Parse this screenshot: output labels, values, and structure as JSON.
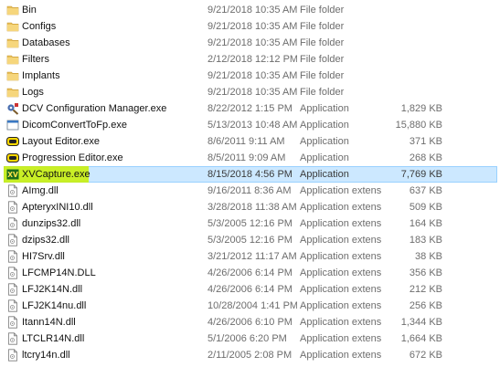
{
  "files": [
    {
      "name": "Bin",
      "date": "9/21/2018 10:35 AM",
      "type": "File folder",
      "size": "",
      "icon": "folder-icon"
    },
    {
      "name": "Configs",
      "date": "9/21/2018 10:35 AM",
      "type": "File folder",
      "size": "",
      "icon": "folder-icon"
    },
    {
      "name": "Databases",
      "date": "9/21/2018 10:35 AM",
      "type": "File folder",
      "size": "",
      "icon": "folder-icon"
    },
    {
      "name": "Filters",
      "date": "2/12/2018 12:12 PM",
      "type": "File folder",
      "size": "",
      "icon": "folder-icon"
    },
    {
      "name": "Implants",
      "date": "9/21/2018 10:35 AM",
      "type": "File folder",
      "size": "",
      "icon": "folder-icon"
    },
    {
      "name": "Logs",
      "date": "9/21/2018 10:35 AM",
      "type": "File folder",
      "size": "",
      "icon": "folder-icon"
    },
    {
      "name": "DCV Configuration Manager.exe",
      "date": "8/22/2012 1:15 PM",
      "type": "Application",
      "size": "1,829 KB",
      "icon": "dcv-config-app-icon"
    },
    {
      "name": "DicomConvertToFp.exe",
      "date": "5/13/2013 10:48 AM",
      "type": "Application",
      "size": "15,880 KB",
      "icon": "application-window-icon"
    },
    {
      "name": "Layout Editor.exe",
      "date": "8/6/2011 9:11 AM",
      "type": "Application",
      "size": "371 KB",
      "icon": "layout-editor-app-icon"
    },
    {
      "name": "Progression Editor.exe",
      "date": "8/5/2011 9:09 AM",
      "type": "Application",
      "size": "268 KB",
      "icon": "progression-editor-app-icon"
    },
    {
      "name": "XVCapture.exe",
      "date": "8/15/2018 4:56 PM",
      "type": "Application",
      "size": "7,769 KB",
      "icon": "xv-capture-app-icon",
      "selected": true
    },
    {
      "name": "AImg.dll",
      "date": "9/16/2011 8:36 AM",
      "type": "Application extens",
      "size": "637 KB",
      "icon": "dll-file-icon"
    },
    {
      "name": "ApteryxINI10.dll",
      "date": "3/28/2018 11:38 AM",
      "type": "Application extens",
      "size": "509 KB",
      "icon": "dll-file-icon"
    },
    {
      "name": "dunzips32.dll",
      "date": "5/3/2005 12:16 PM",
      "type": "Application extens",
      "size": "164 KB",
      "icon": "dll-file-icon"
    },
    {
      "name": "dzips32.dll",
      "date": "5/3/2005 12:16 PM",
      "type": "Application extens",
      "size": "183 KB",
      "icon": "dll-file-icon"
    },
    {
      "name": "HI7Srv.dll",
      "date": "3/21/2012 11:17 AM",
      "type": "Application extens",
      "size": "38 KB",
      "icon": "dll-file-icon"
    },
    {
      "name": "LFCMP14N.DLL",
      "date": "4/26/2006 6:14 PM",
      "type": "Application extens",
      "size": "356 KB",
      "icon": "dll-file-icon"
    },
    {
      "name": "LFJ2K14N.dll",
      "date": "4/26/2006 6:14 PM",
      "type": "Application extens",
      "size": "212 KB",
      "icon": "dll-file-icon"
    },
    {
      "name": "LFJ2K14nu.dll",
      "date": "10/28/2004 1:41 PM",
      "type": "Application extens",
      "size": "256 KB",
      "icon": "dll-file-icon"
    },
    {
      "name": "Itann14N.dll",
      "date": "4/26/2006 6:10 PM",
      "type": "Application extens",
      "size": "1,344 KB",
      "icon": "dll-file-icon"
    },
    {
      "name": "LTCLR14N.dll",
      "date": "5/1/2006 6:20 PM",
      "type": "Application extens",
      "size": "1,664 KB",
      "icon": "dll-file-icon"
    },
    {
      "name": "ltcry14n.dll",
      "date": "2/11/2005 2:08 PM",
      "type": "Application extens",
      "size": "672 KB",
      "icon": "dll-file-icon"
    }
  ],
  "colors": {
    "selection_bg": "#cce8ff",
    "selection_border": "#99d1ff",
    "highlighter": "#c8f000",
    "folder": "#dcb456",
    "detail_text": "#6d6d6d"
  }
}
